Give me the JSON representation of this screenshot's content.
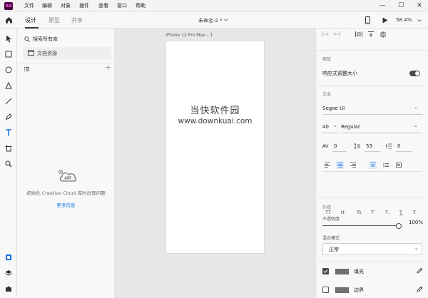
{
  "app": {
    "logo": "Xd",
    "accent": "#470137",
    "link_color": "#1473e6",
    "fill_color": "#707070"
  },
  "menu": {
    "items": [
      "文件",
      "编辑",
      "对象",
      "插件",
      "查看",
      "窗口",
      "帮助"
    ]
  },
  "window_controls": {
    "minimize": "—",
    "maximize": "☐",
    "close": "✕"
  },
  "toolbar": {
    "tabs": [
      "设计",
      "原型",
      "共享"
    ],
    "active_tab": "设计",
    "document_title": "未命名-2 *",
    "zoom_level": "58.4%"
  },
  "tools": [
    "select-tool-icon",
    "rectangle-tool-icon",
    "ellipse-tool-icon",
    "polygon-tool-icon",
    "line-tool-icon",
    "pen-tool-icon",
    "text-tool-icon",
    "artboard-tool-icon",
    "zoom-tool-icon"
  ],
  "bottom_tools": [
    "assets-icon",
    "layers-icon",
    "plugins-icon"
  ],
  "library": {
    "search_placeholder": "搜索所有库",
    "document_assets": "文档资源",
    "empty_message": "初始化 Creative Cloud 库时出现问题",
    "more_link": "更多信息"
  },
  "canvas": {
    "artboard_name": "iPhone 12 Pro Max – 1",
    "watermark_cn": "当快软件园",
    "watermark_url": "www.downkuai.com"
  },
  "inspector": {
    "responsive_section": "缩放",
    "responsive_label": "响应式调整大小",
    "responsive_on": true,
    "text_section": "文本",
    "font_family": "Segoe UI",
    "font_size": "40",
    "font_weight": "Regular",
    "char_spacing": "0",
    "line_spacing": "53",
    "para_spacing": "0",
    "text_transform_buttons": [
      "TT",
      "tt",
      "Tt",
      "T'",
      "T,",
      "T",
      "Ŧ"
    ],
    "appearance_section": "外观",
    "opacity_label": "不透明度",
    "opacity_value": "100%",
    "opacity": 1.0,
    "blend_label": "混合模式",
    "blend_value": "正常",
    "fill_label": "填充",
    "fill_checked": true,
    "border_label": "边界",
    "border_checked": false
  }
}
